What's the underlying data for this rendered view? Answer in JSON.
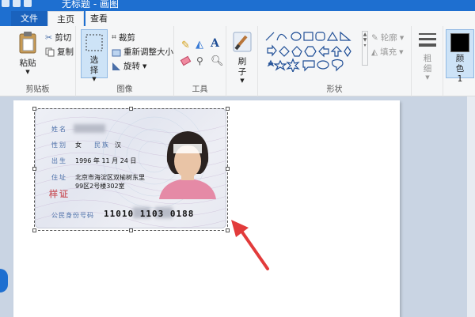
{
  "title_bar": {
    "title": "无标题 - 画图"
  },
  "tabs": [
    {
      "label": "文件"
    },
    {
      "label": "主页"
    },
    {
      "label": "查看"
    }
  ],
  "clipboard": {
    "paste": "粘贴",
    "cut": "剪切",
    "copy": "复制",
    "group": "剪贴板"
  },
  "image": {
    "select": "选择",
    "crop": "裁剪",
    "resize": "重新调整大小",
    "rotate": "旋转",
    "group": "图像"
  },
  "tools": {
    "group": "工具"
  },
  "brush": {
    "label": "刷子"
  },
  "shapes": {
    "outline": "轮廓",
    "fill": "填充",
    "group": "形状"
  },
  "size": {
    "label": "粗细"
  },
  "color1": {
    "label": "颜色 1"
  },
  "id_card": {
    "name_label": "姓名",
    "gender_label": "性别",
    "gender": "女",
    "ethnicity_label": "民族",
    "ethnicity": "汉",
    "birth_label": "出生",
    "birth": "1996 年 11 月 24 日",
    "address_label": "住址",
    "address_line1": "北京市海淀区双榆树东里",
    "address_line2": "99区2号楼302室",
    "stamp": "样证",
    "id_label": "公民身份号码",
    "id_number": "11010      1103 0188"
  },
  "colors": {
    "accent": "#1e6fd0",
    "canvas_bg": "#c9d4e3",
    "arrow": "#e23b3b"
  }
}
